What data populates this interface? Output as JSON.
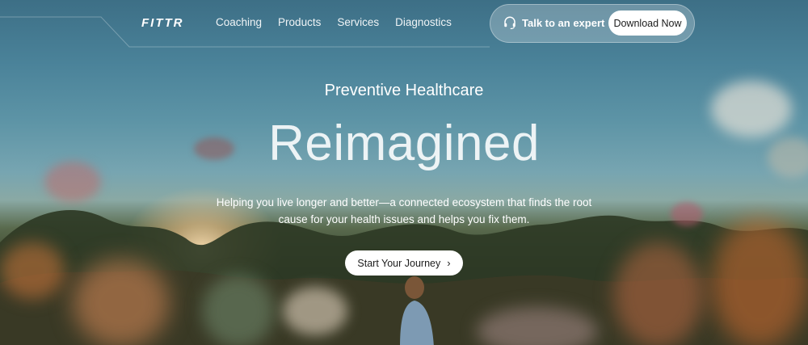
{
  "brand": {
    "logo": "FITTR"
  },
  "nav": {
    "items": [
      "Coaching",
      "Products",
      "Services",
      "Diagnostics"
    ]
  },
  "header": {
    "expert_label": "Talk to an expert",
    "download_label": "Download Now"
  },
  "hero": {
    "eyebrow": "Preventive Healthcare",
    "headline": "Reimagined",
    "subtitle": "Helping you live longer and better—a connected ecosystem that finds the root cause for your health issues and helps you fix them.",
    "cta_label": "Start Your Journey",
    "cta_icon": "chevron-right-icon"
  },
  "icons": {
    "expert": "headset-icon"
  },
  "colors": {
    "sky_top": "#3d6f86",
    "cta_bg": "#ffffff",
    "cta_text": "#1c1c1c"
  }
}
